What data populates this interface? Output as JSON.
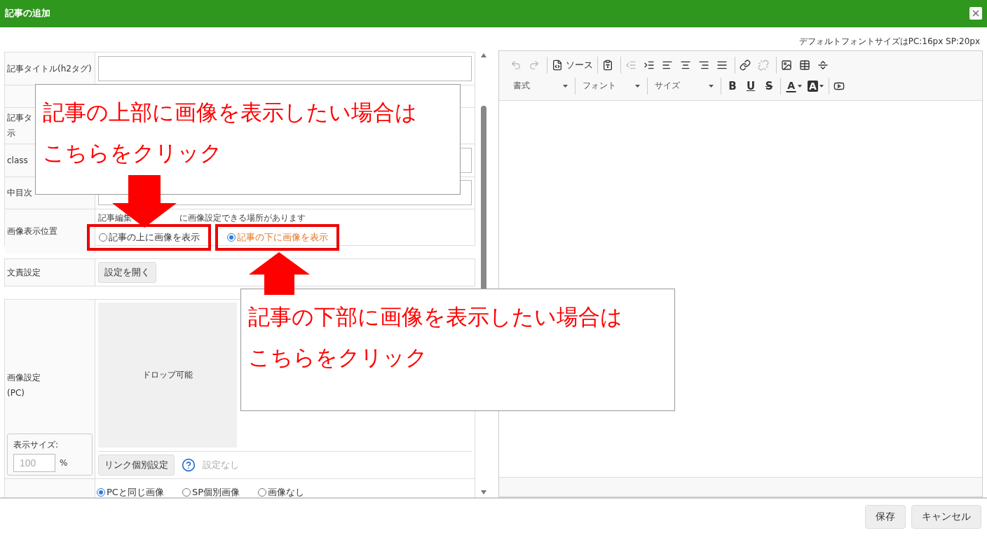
{
  "window": {
    "title": "記事の追加"
  },
  "font_note": "デフォルトフォントサイズはPC:16px SP:20px",
  "form": {
    "sections": [
      {
        "rows": [
          {
            "kind": "input",
            "label_lines": [
              "記事タイトル(h2タグ)"
            ]
          },
          {
            "kind": "empty",
            "label_lines": []
          },
          {
            "kind": "empty",
            "label_lines": [
              "記事タ",
              "示"
            ]
          },
          {
            "kind": "input",
            "label_lines": [
              "class"
            ]
          },
          {
            "kind": "input",
            "label_lines": [
              "中目次"
            ]
          },
          {
            "kind": "radios",
            "label_lines": [
              "画像表示位置"
            ],
            "note_parts": [
              "記事編集",
              "に画像設定できる場所があります"
            ],
            "options": [
              {
                "label": "記事の上に画像を表示",
                "selected": false,
                "highlighted": true
              },
              {
                "label": "記事の下に画像を表示",
                "selected": true,
                "highlighted": true
              }
            ]
          }
        ]
      },
      {
        "rows": [
          {
            "kind": "button",
            "label_lines": [
              "文責設定"
            ],
            "button": "設定を開く"
          }
        ]
      },
      {
        "rows": [
          {
            "kind": "image",
            "label_lines": [
              "画像設定",
              "(PC)"
            ],
            "drop_text": "ドロップ可能",
            "size_label": "表示サイズ:",
            "size_value": "100",
            "size_unit": "%",
            "link_button": "リンク個別設定",
            "link_status": "設定なし"
          },
          {
            "kind": "radios",
            "label_lines": [],
            "options": [
              {
                "label": "PCと同じ画像",
                "selected": true,
                "highlighted": false
              },
              {
                "label": "SP個別画像",
                "selected": false,
                "highlighted": false
              },
              {
                "label": "画像なし",
                "selected": false,
                "highlighted": false
              }
            ]
          }
        ]
      }
    ]
  },
  "editor": {
    "toolbar": [
      [
        [
          {
            "kind": "undo",
            "disabled": true
          },
          {
            "kind": "redo",
            "disabled": true
          }
        ],
        [
          {
            "kind": "source",
            "label": "ソース",
            "disabled": false
          }
        ],
        [
          {
            "kind": "paste",
            "disabled": false
          }
        ],
        [
          {
            "kind": "outdent",
            "disabled": true
          },
          {
            "kind": "indent",
            "disabled": false
          },
          {
            "kind": "align-left",
            "disabled": false
          },
          {
            "kind": "align-center",
            "disabled": false
          },
          {
            "kind": "align-right",
            "disabled": false
          },
          {
            "kind": "justify",
            "disabled": false
          }
        ],
        [
          {
            "kind": "link",
            "disabled": false
          },
          {
            "kind": "unlink",
            "disabled": true
          }
        ],
        [
          {
            "kind": "image",
            "disabled": false
          },
          {
            "kind": "table",
            "disabled": false
          },
          {
            "kind": "rule",
            "disabled": false
          }
        ]
      ],
      [
        [
          {
            "kind": "dropdown",
            "label": "書式",
            "disabled": false
          }
        ],
        [
          {
            "kind": "dropdown",
            "label": "フォント",
            "disabled": false
          }
        ],
        [
          {
            "kind": "dropdown",
            "label": "サイズ",
            "disabled": false
          }
        ],
        [
          {
            "kind": "letter",
            "label": "B",
            "disabled": false
          },
          {
            "kind": "letter",
            "label": "U",
            "disabled": false
          },
          {
            "kind": "letter",
            "label": "S",
            "disabled": false
          }
        ],
        [
          {
            "kind": "color",
            "label": "A",
            "disabled": false
          },
          {
            "kind": "color",
            "label": "A",
            "disabled": false
          }
        ],
        [
          {
            "kind": "video",
            "disabled": false
          }
        ]
      ]
    ]
  },
  "callouts": [
    {
      "lines": [
        "記事の上部に画像を表示したい場合は",
        "こちらをクリック"
      ]
    },
    {
      "lines": [
        "記事の下部に画像を表示したい場合は",
        "こちらをクリック"
      ]
    }
  ],
  "footer": {
    "buttons": [
      "保存",
      "キャンセル"
    ]
  }
}
